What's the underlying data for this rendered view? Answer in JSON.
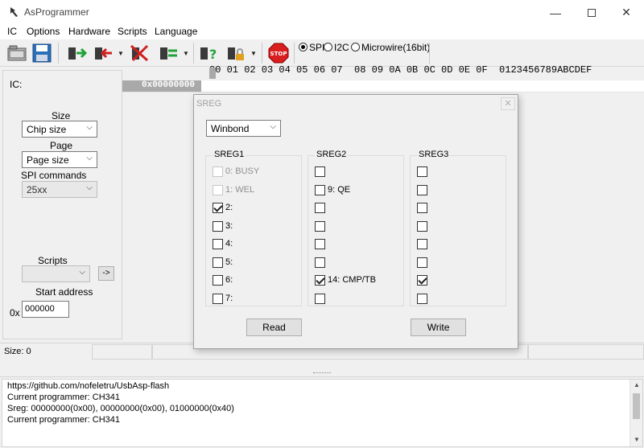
{
  "window": {
    "title": "AsProgrammer"
  },
  "menu": [
    "IC",
    "Options",
    "Hardware",
    "Scripts",
    "Language"
  ],
  "toolbar": {
    "buttons": [
      "open-file-icon",
      "save-icon",
      "read-chip-icon",
      "write-chip-icon",
      "erase-chip-icon",
      "verify-icon",
      "read-id-icon",
      "lock-icon",
      "stop-icon"
    ],
    "stop_label": "STOP",
    "protocols": [
      {
        "label": "SPI",
        "selected": true
      },
      {
        "label": "I2C",
        "selected": false
      },
      {
        "label": "Microwire(16bit)",
        "selected": false
      }
    ]
  },
  "left": {
    "ic_label": "IC:",
    "size_label": "Size",
    "size_value": "Chip size",
    "page_label": "Page",
    "page_value": "Page size",
    "spi_label": "SPI commands",
    "spi_value": "25xx",
    "scripts_label": "Scripts",
    "scripts_value": "",
    "run_label": "->",
    "start_label": "Start address",
    "addr_prefix": "0x",
    "addr_value": "000000"
  },
  "hex": {
    "header": "00 01 02 03 04 05 06 07  08 09 0A 0B 0C 0D 0E 0F  0123456789ABCDEF",
    "first_address": "0x00000000"
  },
  "sreg": {
    "title": "SREG",
    "vendor": "Winbond",
    "groups": [
      {
        "title": "SREG1",
        "bits": [
          {
            "label": "0: BUSY",
            "checked": false,
            "disabled": true
          },
          {
            "label": "1: WEL",
            "checked": false,
            "disabled": true
          },
          {
            "label": "2:",
            "checked": true,
            "disabled": false
          },
          {
            "label": "3:",
            "checked": false,
            "disabled": false
          },
          {
            "label": "4:",
            "checked": false,
            "disabled": false
          },
          {
            "label": "5:",
            "checked": false,
            "disabled": false
          },
          {
            "label": "6:",
            "checked": false,
            "disabled": false
          },
          {
            "label": "7:",
            "checked": false,
            "disabled": false
          }
        ]
      },
      {
        "title": "SREG2",
        "bits": [
          {
            "label": "",
            "checked": false,
            "disabled": false
          },
          {
            "label": "9: QE",
            "checked": false,
            "disabled": false
          },
          {
            "label": "",
            "checked": false,
            "disabled": false
          },
          {
            "label": "",
            "checked": false,
            "disabled": false
          },
          {
            "label": "",
            "checked": false,
            "disabled": false
          },
          {
            "label": "",
            "checked": false,
            "disabled": false
          },
          {
            "label": "14: CMP/TB",
            "checked": true,
            "disabled": false
          },
          {
            "label": "",
            "checked": false,
            "disabled": false
          }
        ]
      },
      {
        "title": "SREG3",
        "bits": [
          {
            "label": "",
            "checked": false,
            "disabled": false
          },
          {
            "label": "",
            "checked": false,
            "disabled": false
          },
          {
            "label": "",
            "checked": false,
            "disabled": false
          },
          {
            "label": "",
            "checked": false,
            "disabled": false
          },
          {
            "label": "",
            "checked": false,
            "disabled": false
          },
          {
            "label": "",
            "checked": false,
            "disabled": false
          },
          {
            "label": "",
            "checked": true,
            "disabled": false
          },
          {
            "label": "",
            "checked": false,
            "disabled": false
          }
        ]
      }
    ],
    "read_label": "Read",
    "write_label": "Write"
  },
  "status": {
    "size": "Size: 0"
  },
  "log": [
    "https://github.com/nofeletru/UsbAsp-flash",
    "Current programmer: CH341",
    "Sreg: 00000000(0x00), 00000000(0x00), 01000000(0x40)",
    "Current programmer: CH341"
  ]
}
